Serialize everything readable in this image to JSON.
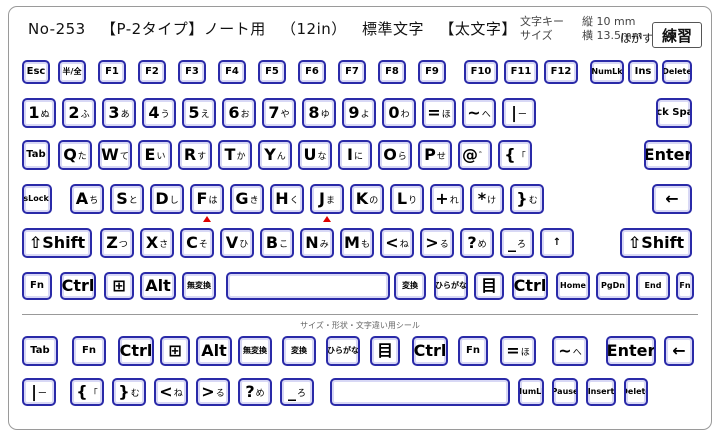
{
  "header": {
    "model": "No-253",
    "product": "【P-2タイプ】ノート用",
    "size": "（12in）",
    "label_type": "標準文字",
    "font_style": "【太文字】",
    "spec_key_label": "文字キー",
    "spec_size_label": "サイズ",
    "spec_h": "縦 10 mm",
    "spec_w": "横 13.5mm",
    "peel": "はがす",
    "practice": "練習"
  },
  "keys": {
    "esc": "Esc",
    "hankaku": "半/全",
    "f1": "F1",
    "f2": "F2",
    "f3": "F3",
    "f4": "F4",
    "f5": "F5",
    "f6": "F6",
    "f7": "F7",
    "f8": "F8",
    "f9": "F9",
    "f10": "F10",
    "f11": "F11",
    "f12": "F12",
    "numlk": "NumLk",
    "ins": "Ins",
    "del": "Delete",
    "n1": "1",
    "n2": "2",
    "n3": "3",
    "n4": "4",
    "n5": "5",
    "n6": "6",
    "n7": "7",
    "n8": "8",
    "n9": "9",
    "n0": "0",
    "minus": "=",
    "caret": "~",
    "yen": "|",
    "bs": "Back Space",
    "k1": "ぬ",
    "k2": "ふ",
    "k3": "あ",
    "k4": "う",
    "k5": "え",
    "k6": "お",
    "k7": "や",
    "k8": "ゆ",
    "k9": "よ",
    "k0": "わ",
    "kminus": "ほ",
    "kcaret": "へ",
    "kyen": "ー",
    "tab": "Tab",
    "q": "Q",
    "w": "W",
    "e": "E",
    "r": "R",
    "t": "T",
    "y": "Y",
    "u": "U",
    "i": "I",
    "o": "O",
    "p": "P",
    "at": "@",
    "lbr": "{",
    "enter": "Enter",
    "kq": "た",
    "kw": "て",
    "ke": "い",
    "kr": "す",
    "kt": "か",
    "ky": "ん",
    "ku": "な",
    "ki": "に",
    "ko": "ら",
    "kp": "せ",
    "kat": "゛",
    "klbr": "「",
    "caps": "CapsLock 英数",
    "a": "A",
    "s": "S",
    "d": "D",
    "f": "F",
    "g": "G",
    "h": "H",
    "j": "J",
    "k": "K",
    "l": "L",
    "semi": "+",
    "colon": "*",
    "rbr": "}",
    "ka": "ち",
    "ks": "と",
    "kd": "し",
    "kf": "は",
    "kg": "き",
    "kh": "く",
    "kj": "ま",
    "kk": "の",
    "kl": "り",
    "ksemi": "れ",
    "kcolon": "け",
    "krbr": "む",
    "shift": "⇧Shift",
    "z": "Z",
    "x": "X",
    "c": "C",
    "v": "V",
    "b": "B",
    "n": "N",
    "m": "M",
    "comma": "<",
    "period": ">",
    "slash": "?",
    "bslash": "_",
    "pgup": "↑",
    "kz": "つ",
    "kx": "さ",
    "kc": "そ",
    "kv": "ひ",
    "kb": "こ",
    "kn": "み",
    "km": "も",
    "kcomma": "ね",
    "kperiod": "る",
    "kslash": "め",
    "kbslash": "ろ",
    "fn": "Fn",
    "ctrl": "Ctrl",
    "win": "⊞",
    "alt": "Alt",
    "muhenkan": "無変換",
    "henkan": "変換",
    "kana": "カタカナ ひらがな ローマ字",
    "app": "目",
    "home": "Home",
    "pgdn": "PgDn",
    "end": "End"
  },
  "separator_label": "サイズ・形状・文字違い用シール",
  "colors": {
    "key_border": "#2a2aa8",
    "marker": "#e00000"
  }
}
